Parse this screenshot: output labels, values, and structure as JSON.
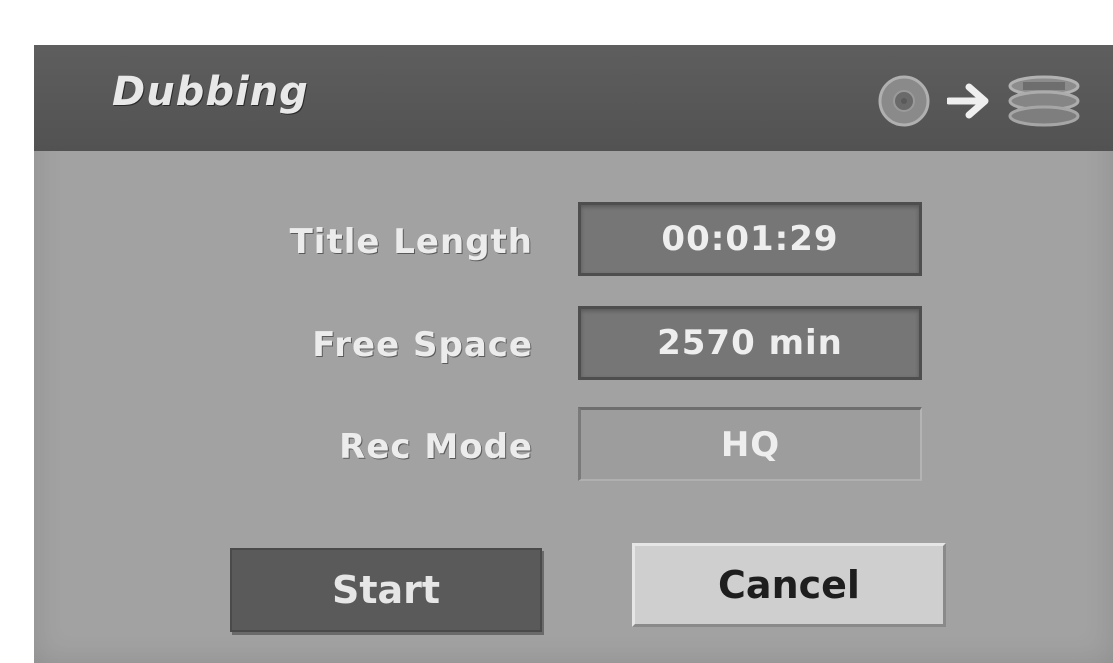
{
  "dialog": {
    "title": "Dubbing",
    "icons": [
      "disc-icon",
      "arrow-right-icon",
      "tape-stack-icon"
    ]
  },
  "fields": {
    "title_length": {
      "label": "Title Length",
      "value": "00:01:29"
    },
    "free_space": {
      "label": "Free Space",
      "value": "2570 min"
    },
    "rec_mode": {
      "label": "Rec Mode",
      "value": "HQ"
    }
  },
  "buttons": {
    "start_label": "Start",
    "cancel_label": "Cancel"
  },
  "colors": {
    "panel": "#a2a2a2",
    "titlebar": "#595959",
    "selected_button": "#5a5a5a",
    "unselected_button": "#cfcfcf"
  }
}
